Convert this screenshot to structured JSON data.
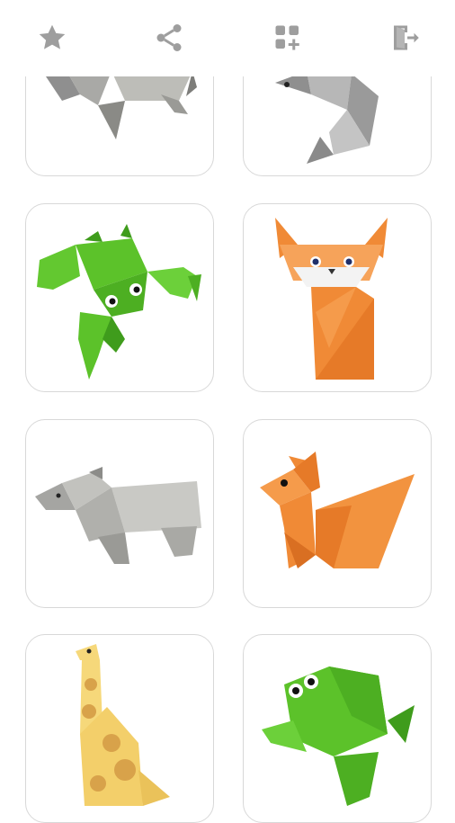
{
  "toolbar": {
    "items": [
      {
        "name": "favorites-button",
        "icon": "star-icon"
      },
      {
        "name": "share-button",
        "icon": "share-icon"
      },
      {
        "name": "more-apps-button",
        "icon": "apps-add-icon"
      },
      {
        "name": "exit-button",
        "icon": "exit-icon"
      }
    ],
    "icon_color": "#9e9e9e"
  },
  "grid": {
    "cards": [
      {
        "animal": "dog"
      },
      {
        "animal": "mouse"
      },
      {
        "animal": "frog"
      },
      {
        "animal": "cat"
      },
      {
        "animal": "bear"
      },
      {
        "animal": "squirrel"
      },
      {
        "animal": "giraffe"
      },
      {
        "animal": "jumping-frog"
      }
    ]
  },
  "colors": {
    "card_border": "#d8d8d8",
    "green": "#5cc22a",
    "orange": "#f08a36",
    "gray": "#b3b3b3",
    "yellow": "#f6d87a"
  }
}
